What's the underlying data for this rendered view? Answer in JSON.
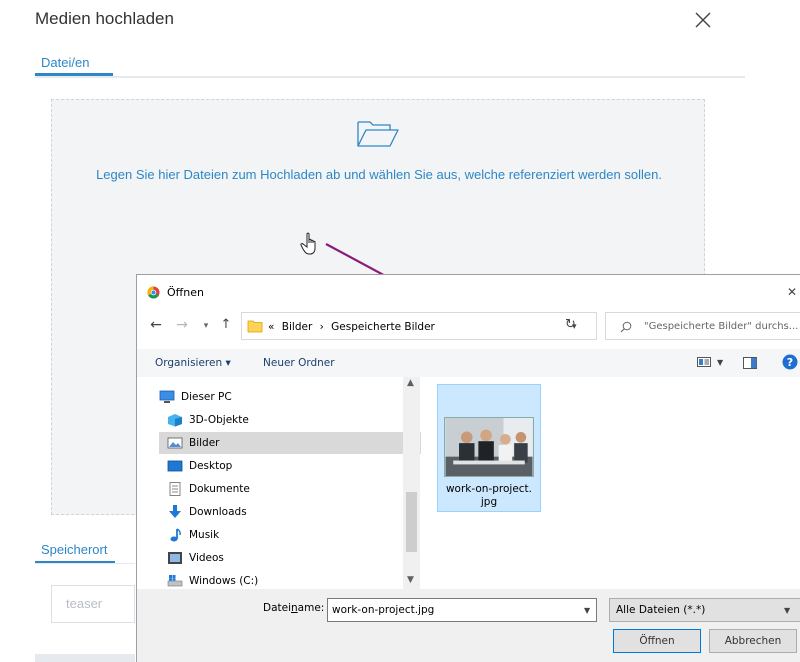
{
  "modal": {
    "title": "Medien hochladen",
    "files_tab": "Datei/en",
    "drop_text": "Legen Sie hier Dateien zum Hochladen ab und wählen Sie aus, welche referenziert werden sollen.",
    "location_tab": "Speicherort",
    "location_placeholder": "teaser",
    "accent_color": "#2d87c7",
    "arrow_color": "#8b1a7a"
  },
  "dialog": {
    "title": "Öffnen",
    "breadcrumb": {
      "overflow": "«",
      "items": [
        "Bilder",
        "Gespeicherte Bilder"
      ],
      "separator": "›"
    },
    "search_placeholder": "\"Gespeicherte Bilder\" durchs...",
    "toolbar": {
      "organize": "Organisieren ▾",
      "new_folder": "Neuer Ordner"
    },
    "tree": [
      {
        "label": "Dieser PC",
        "icon": "computer-icon"
      },
      {
        "label": "3D-Objekte",
        "icon": "3d-objects-icon"
      },
      {
        "label": "Bilder",
        "icon": "pictures-icon",
        "selected": true
      },
      {
        "label": "Desktop",
        "icon": "desktop-icon"
      },
      {
        "label": "Dokumente",
        "icon": "documents-icon"
      },
      {
        "label": "Downloads",
        "icon": "downloads-icon"
      },
      {
        "label": "Musik",
        "icon": "music-icon"
      },
      {
        "label": "Videos",
        "icon": "videos-icon"
      },
      {
        "label": "Windows (C:)",
        "icon": "drive-icon"
      }
    ],
    "file": {
      "name": "work-on-project.jpg",
      "name_line1": "work-on-project.",
      "name_line2": "jpg"
    },
    "filename_label_pre": "Datei",
    "filename_label_underlined": "n",
    "filename_label_post": "ame:",
    "filename_value": "work-on-project.jpg",
    "file_type": "Alle Dateien (*.*)",
    "open_button": "Öffnen",
    "cancel_button": "Abbrechen"
  }
}
